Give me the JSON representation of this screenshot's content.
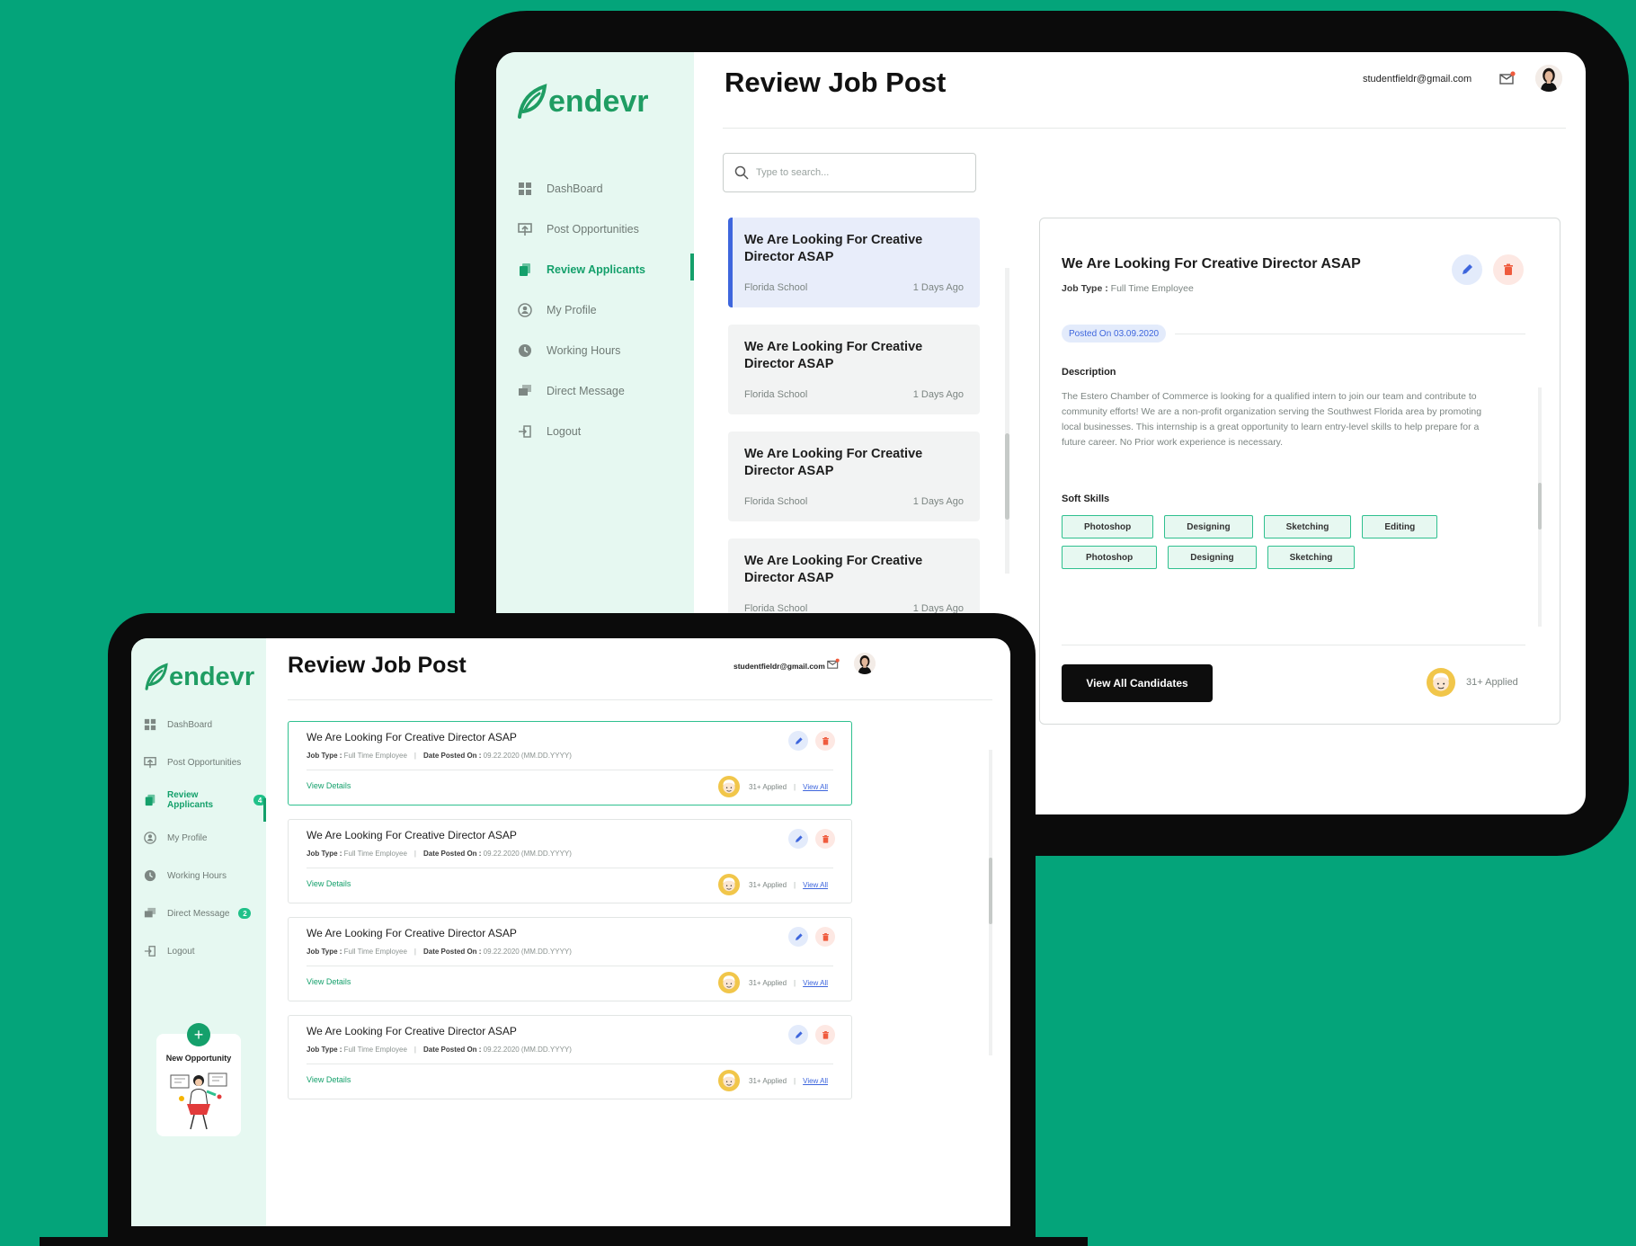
{
  "brand": {
    "name": "endevr"
  },
  "colors": {
    "background": "#04a47a",
    "accent": "#14a06b",
    "edit": "#3e66dd",
    "delete": "#ef5b3d"
  },
  "header": {
    "title": "Review Job Post",
    "email": "studentfieldr@gmail.com"
  },
  "back_sidebar": {
    "items": [
      {
        "label": "DashBoard",
        "icon": "dashboard-icon"
      },
      {
        "label": "Post Opportunities",
        "icon": "post-icon"
      },
      {
        "label": "Review Applicants",
        "icon": "applicants-icon",
        "active": true
      },
      {
        "label": "My Profile",
        "icon": "profile-icon"
      },
      {
        "label": "Working Hours",
        "icon": "clock-icon"
      },
      {
        "label": "Direct Message",
        "icon": "message-icon"
      },
      {
        "label": "Logout",
        "icon": "logout-icon"
      }
    ]
  },
  "front_sidebar": {
    "items": [
      {
        "label": "DashBoard",
        "icon": "dashboard-icon"
      },
      {
        "label": "Post Opportunities",
        "icon": "post-icon"
      },
      {
        "label": "Review Applicants",
        "icon": "applicants-icon",
        "badge": "4",
        "active": true
      },
      {
        "label": "My Profile",
        "icon": "profile-icon"
      },
      {
        "label": "Working Hours",
        "icon": "clock-icon"
      },
      {
        "label": "Direct Message",
        "icon": "message-icon",
        "badge": "2"
      },
      {
        "label": "Logout",
        "icon": "logout-icon"
      }
    ],
    "new_opportunity": {
      "plus": "+",
      "label": "New Opportunity"
    }
  },
  "search": {
    "placeholder": "Type to search..."
  },
  "job_list": [
    {
      "title": "We Are Looking For Creative Director ASAP",
      "school": "Florida School",
      "age": "1 Days Ago"
    },
    {
      "title": "We Are Looking For Creative Director ASAP",
      "school": "Florida School",
      "age": "1 Days Ago"
    },
    {
      "title": "We Are Looking For Creative Director ASAP",
      "school": "Florida School",
      "age": "1 Days Ago"
    },
    {
      "title": "We Are Looking For Creative Director ASAP",
      "school": "Florida School",
      "age": "1 Days Ago"
    }
  ],
  "detail": {
    "title": "We Are Looking For Creative Director ASAP",
    "job_type_label": "Job Type :",
    "job_type": "Full Time Employee",
    "posted": "Posted On 03.09.2020",
    "description_heading": "Description",
    "description": "The Estero Chamber of Commerce is looking for a qualified intern to join our team and contribute to community efforts! We are a non-profit organization serving the Southwest Florida area by promoting local businesses. This internship is a great opportunity to learn entry-level skills to help prepare for a future career. No Prior work experience is necessary.",
    "skills_heading": "Soft Skills",
    "skills": [
      "Photoshop",
      "Designing",
      "Sketching",
      "Editing",
      "Photoshop",
      "Designing",
      "Sketching"
    ],
    "view_all_button": "View All Candidates",
    "applied": "31+ Applied"
  },
  "posts": [
    {
      "title": "We Are Looking For Creative Director ASAP",
      "job_type_label": "Job Type :",
      "job_type": "Full Time Employee",
      "date_label": "Date Posted On :",
      "date": "09.22.2020 (MM.DD.YYYY)",
      "view_details": "View Details",
      "applied": "31+ Applied",
      "view_all": "View All"
    },
    {
      "title": "We Are Looking For Creative Director ASAP",
      "job_type_label": "Job Type :",
      "job_type": "Full Time Employee",
      "date_label": "Date Posted On :",
      "date": "09.22.2020 (MM.DD.YYYY)",
      "view_details": "View Details",
      "applied": "31+ Applied",
      "view_all": "View All"
    },
    {
      "title": "We Are Looking For Creative Director ASAP",
      "job_type_label": "Job Type :",
      "job_type": "Full Time Employee",
      "date_label": "Date Posted On :",
      "date": "09.22.2020 (MM.DD.YYYY)",
      "view_details": "View Details",
      "applied": "31+ Applied",
      "view_all": "View All"
    },
    {
      "title": "We Are Looking For Creative Director ASAP",
      "job_type_label": "Job Type :",
      "job_type": "Full Time Employee",
      "date_label": "Date Posted On :",
      "date": "09.22.2020 (MM.DD.YYYY)",
      "view_details": "View Details",
      "applied": "31+ Applied",
      "view_all": "View All"
    }
  ]
}
